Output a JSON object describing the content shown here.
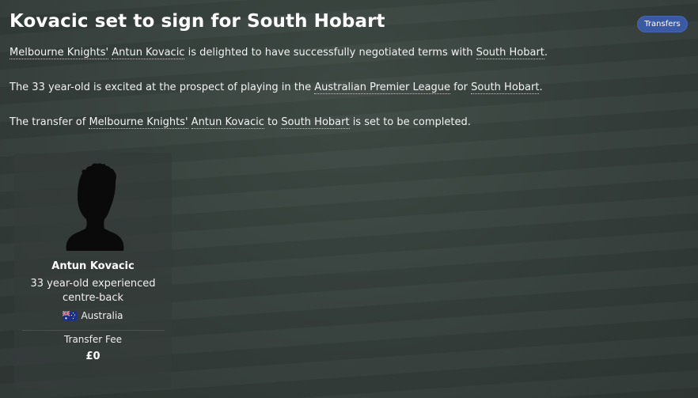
{
  "news": {
    "headline": "Kovacic set to sign for South Hobart",
    "tag": "Transfers",
    "paragraphs": [
      {
        "parts": [
          {
            "text": "Melbourne Knights'",
            "link": true
          },
          {
            "text": " ",
            "link": false
          },
          {
            "text": "Antun Kovacic",
            "link": true
          },
          {
            "text": " is delighted to have successfully negotiated terms with ",
            "link": false
          },
          {
            "text": "South Hobart",
            "link": true
          },
          {
            "text": ".",
            "link": false
          }
        ]
      },
      {
        "parts": [
          {
            "text": "The 33 year-old is excited at the prospect of playing in the ",
            "link": false
          },
          {
            "text": "Australian Premier League",
            "link": true
          },
          {
            "text": " for ",
            "link": false
          },
          {
            "text": "South Hobart",
            "link": true
          },
          {
            "text": ".",
            "link": false
          }
        ]
      },
      {
        "parts": [
          {
            "text": "The transfer of ",
            "link": false
          },
          {
            "text": "Melbourne Knights'",
            "link": true
          },
          {
            "text": " ",
            "link": false
          },
          {
            "text": "Antun Kovacic",
            "link": true
          },
          {
            "text": " to ",
            "link": false
          },
          {
            "text": "South Hobart",
            "link": true
          },
          {
            "text": " is set to be completed.",
            "link": false
          }
        ]
      }
    ]
  },
  "player_card": {
    "name": "Antun Kovacic",
    "description": "33 year-old experienced centre-back",
    "nationality": "Australia",
    "fee_label": "Transfer Fee",
    "fee_value": "£0",
    "portrait_icon": "player-silhouette-icon",
    "flag_icon": "australia-flag-icon"
  },
  "colors": {
    "tag_background": "#3b5aa6",
    "card_background": "#343c3a"
  }
}
